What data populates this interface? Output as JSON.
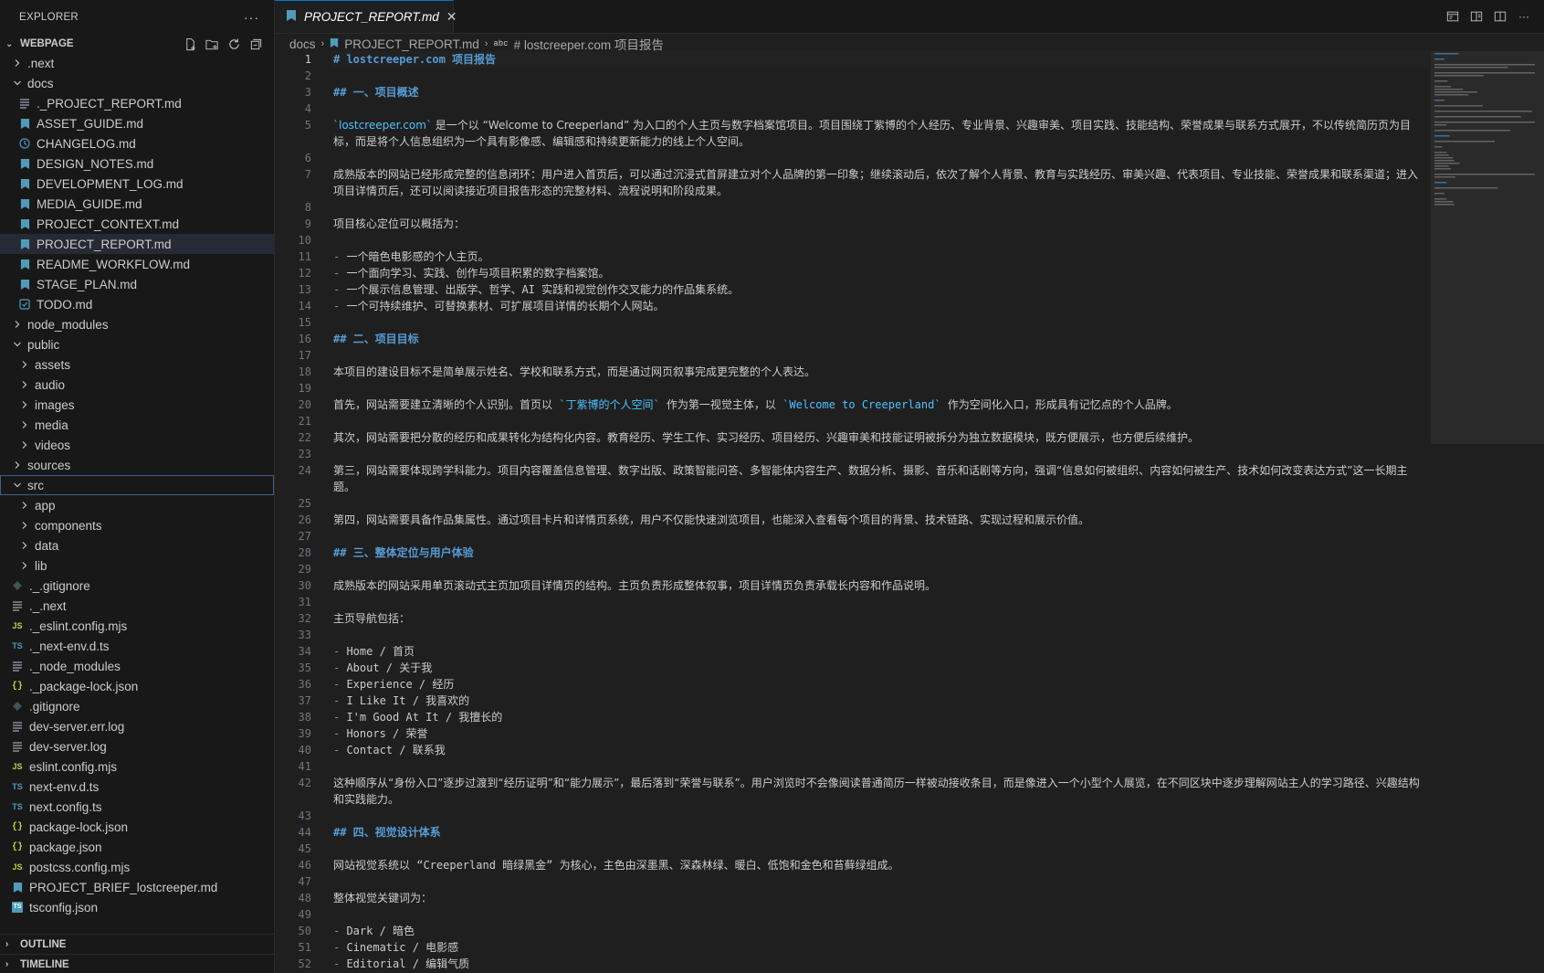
{
  "explorer": {
    "title": "EXPLORER",
    "more": "···",
    "workspace": "WEBPAGE",
    "items": [
      {
        "label": ".next",
        "kind": "folder",
        "depth": 0,
        "open": false
      },
      {
        "label": "docs",
        "kind": "folder",
        "depth": 0,
        "open": true
      },
      {
        "label": "._PROJECT_REPORT.md",
        "kind": "lines",
        "depth": 1
      },
      {
        "label": "ASSET_GUIDE.md",
        "kind": "md",
        "depth": 1
      },
      {
        "label": "CHANGELOG.md",
        "kind": "clock",
        "depth": 1
      },
      {
        "label": "DESIGN_NOTES.md",
        "kind": "md",
        "depth": 1
      },
      {
        "label": "DEVELOPMENT_LOG.md",
        "kind": "md",
        "depth": 1
      },
      {
        "label": "MEDIA_GUIDE.md",
        "kind": "md",
        "depth": 1
      },
      {
        "label": "PROJECT_CONTEXT.md",
        "kind": "md",
        "depth": 1
      },
      {
        "label": "PROJECT_REPORT.md",
        "kind": "md",
        "depth": 1,
        "selected": true
      },
      {
        "label": "README_WORKFLOW.md",
        "kind": "md",
        "depth": 1
      },
      {
        "label": "STAGE_PLAN.md",
        "kind": "md",
        "depth": 1
      },
      {
        "label": "TODO.md",
        "kind": "check",
        "depth": 1
      },
      {
        "label": "node_modules",
        "kind": "folder",
        "depth": 0,
        "open": false
      },
      {
        "label": "public",
        "kind": "folder",
        "depth": 0,
        "open": true
      },
      {
        "label": "assets",
        "kind": "folder",
        "depth": 1,
        "open": false
      },
      {
        "label": "audio",
        "kind": "folder",
        "depth": 1,
        "open": false
      },
      {
        "label": "images",
        "kind": "folder",
        "depth": 1,
        "open": false
      },
      {
        "label": "media",
        "kind": "folder",
        "depth": 1,
        "open": false
      },
      {
        "label": "videos",
        "kind": "folder",
        "depth": 1,
        "open": false
      },
      {
        "label": "sources",
        "kind": "folder",
        "depth": 0,
        "open": false
      },
      {
        "label": "src",
        "kind": "folder",
        "depth": 0,
        "open": true,
        "focused": true
      },
      {
        "label": "app",
        "kind": "folder",
        "depth": 1,
        "open": false
      },
      {
        "label": "components",
        "kind": "folder",
        "depth": 1,
        "open": false
      },
      {
        "label": "data",
        "kind": "folder",
        "depth": 1,
        "open": false
      },
      {
        "label": "lib",
        "kind": "folder",
        "depth": 1,
        "open": false
      },
      {
        "label": "._.gitignore",
        "kind": "git",
        "depth": 0
      },
      {
        "label": "._.next",
        "kind": "lines",
        "depth": 0
      },
      {
        "label": "._eslint.config.mjs",
        "kind": "js",
        "depth": 0
      },
      {
        "label": "._next-env.d.ts",
        "kind": "ts",
        "depth": 0
      },
      {
        "label": "._node_modules",
        "kind": "lines",
        "depth": 0
      },
      {
        "label": "._package-lock.json",
        "kind": "json",
        "depth": 0
      },
      {
        "label": ".gitignore",
        "kind": "git",
        "depth": 0
      },
      {
        "label": "dev-server.err.log",
        "kind": "lines",
        "depth": 0
      },
      {
        "label": "dev-server.log",
        "kind": "lines",
        "depth": 0
      },
      {
        "label": "eslint.config.mjs",
        "kind": "js",
        "depth": 0
      },
      {
        "label": "next-env.d.ts",
        "kind": "ts",
        "depth": 0
      },
      {
        "label": "next.config.ts",
        "kind": "ts",
        "depth": 0
      },
      {
        "label": "package-lock.json",
        "kind": "json",
        "depth": 0
      },
      {
        "label": "package.json",
        "kind": "json",
        "depth": 0
      },
      {
        "label": "postcss.config.mjs",
        "kind": "js",
        "depth": 0
      },
      {
        "label": "PROJECT_BRIEF_lostcreeper.md",
        "kind": "md",
        "depth": 0
      },
      {
        "label": "tsconfig.json",
        "kind": "tsconfig",
        "depth": 0
      }
    ],
    "outline": "OUTLINE",
    "timeline": "TIMELINE"
  },
  "editor": {
    "tab_label": "PROJECT_REPORT.md",
    "breadcrumb": [
      "docs",
      "PROJECT_REPORT.md",
      "# lostcreeper.com 项目报告"
    ],
    "active_line": 1,
    "lines": [
      {
        "n": 1,
        "text": "# lostcreeper.com 项目报告",
        "style": "h"
      },
      {
        "n": 2,
        "text": ""
      },
      {
        "n": 3,
        "text": "## 一、项目概述",
        "style": "h"
      },
      {
        "n": 4,
        "text": ""
      },
      {
        "n": 5,
        "text": "`lostcreeper.com` 是一个以 “Welcome to Creeperland” 为入口的个人主页与数字档案馆项目。项目围绕丁紫博的个人经历、专业背景、兴趣审美、项目实践、技能结构、荣誉成果与联系方式展开，不以传统简历页为目标，而是将个人信息组织为一个具有影像感、编辑感和持续更新能力的线上个人空间。",
        "rows": 2
      },
      {
        "n": 6,
        "text": ""
      },
      {
        "n": 7,
        "text": "成熟版本的网站已经形成完整的信息闭环：用户进入首页后，可以通过沉浸式首屏建立对个人品牌的第一印象；继续滚动后，依次了解个人背景、教育与实践经历、审美兴趣、代表项目、专业技能、荣誉成果和联系渠道；进入项目详情页后，还可以阅读接近项目报告形态的完整材料、流程说明和阶段成果。",
        "rows": 2
      },
      {
        "n": 8,
        "text": ""
      },
      {
        "n": 9,
        "text": "项目核心定位可以概括为："
      },
      {
        "n": 10,
        "text": ""
      },
      {
        "n": 11,
        "text": "- 一个暗色电影感的个人主页。",
        "style": "li"
      },
      {
        "n": 12,
        "text": "- 一个面向学习、实践、创作与项目积累的数字档案馆。",
        "style": "li"
      },
      {
        "n": 13,
        "text": "- 一个展示信息管理、出版学、哲学、AI 实践和视觉创作交叉能力的作品集系统。",
        "style": "li"
      },
      {
        "n": 14,
        "text": "- 一个可持续维护、可替换素材、可扩展项目详情的长期个人网站。",
        "style": "li"
      },
      {
        "n": 15,
        "text": ""
      },
      {
        "n": 16,
        "text": "## 二、项目目标",
        "style": "h"
      },
      {
        "n": 17,
        "text": ""
      },
      {
        "n": 18,
        "text": "本项目的建设目标不是简单展示姓名、学校和联系方式，而是通过网页叙事完成更完整的个人表达。"
      },
      {
        "n": 19,
        "text": ""
      },
      {
        "n": 20,
        "text": "首先，网站需要建立清晰的个人识别。首页以 `丁紫博的个人空间` 作为第一视觉主体，以 `Welcome to Creeperland` 作为空间化入口，形成具有记忆点的个人品牌。"
      },
      {
        "n": 21,
        "text": ""
      },
      {
        "n": 22,
        "text": "其次，网站需要把分散的经历和成果转化为结构化内容。教育经历、学生工作、实习经历、项目经历、兴趣审美和技能证明被拆分为独立数据模块，既方便展示，也方便后续维护。"
      },
      {
        "n": 23,
        "text": ""
      },
      {
        "n": 24,
        "text": "第三，网站需要体现跨学科能力。项目内容覆盖信息管理、数字出版、政策智能问答、多智能体内容生产、数据分析、摄影、音乐和话剧等方向，强调“信息如何被组织、内容如何被生产、技术如何改变表达方式”这一长期主题。",
        "rows": 2
      },
      {
        "n": 25,
        "text": ""
      },
      {
        "n": 26,
        "text": "第四，网站需要具备作品集属性。通过项目卡片和详情页系统，用户不仅能快速浏览项目，也能深入查看每个项目的背景、技术链路、实现过程和展示价值。"
      },
      {
        "n": 27,
        "text": ""
      },
      {
        "n": 28,
        "text": "## 三、整体定位与用户体验",
        "style": "h"
      },
      {
        "n": 29,
        "text": ""
      },
      {
        "n": 30,
        "text": "成熟版本的网站采用单页滚动式主页加项目详情页的结构。主页负责形成整体叙事，项目详情页负责承载长内容和作品说明。"
      },
      {
        "n": 31,
        "text": ""
      },
      {
        "n": 32,
        "text": "主页导航包括："
      },
      {
        "n": 33,
        "text": ""
      },
      {
        "n": 34,
        "text": "- Home / 首页",
        "style": "li"
      },
      {
        "n": 35,
        "text": "- About / 关于我",
        "style": "li"
      },
      {
        "n": 36,
        "text": "- Experience / 经历",
        "style": "li"
      },
      {
        "n": 37,
        "text": "- I Like It / 我喜欢的",
        "style": "li"
      },
      {
        "n": 38,
        "text": "- I'm Good At It / 我擅长的",
        "style": "li"
      },
      {
        "n": 39,
        "text": "- Honors / 荣誉",
        "style": "li"
      },
      {
        "n": 40,
        "text": "- Contact / 联系我",
        "style": "li"
      },
      {
        "n": 41,
        "text": ""
      },
      {
        "n": 42,
        "text": "这种顺序从“身份入口”逐步过渡到“经历证明”和“能力展示”，最后落到“荣誉与联系”。用户浏览时不会像阅读普通简历一样被动接收条目，而是像进入一个小型个人展览，在不同区块中逐步理解网站主人的学习路径、兴趣结构和实践能力。",
        "rows": 2
      },
      {
        "n": 43,
        "text": ""
      },
      {
        "n": 44,
        "text": "## 四、视觉设计体系",
        "style": "h"
      },
      {
        "n": 45,
        "text": ""
      },
      {
        "n": 46,
        "text": "网站视觉系统以 “Creeperland 暗绿黑金” 为核心，主色由深墨黑、深森林绿、暖白、低饱和金色和苔藓绿组成。"
      },
      {
        "n": 47,
        "text": ""
      },
      {
        "n": 48,
        "text": "整体视觉关键词为："
      },
      {
        "n": 49,
        "text": ""
      },
      {
        "n": 50,
        "text": "- Dark / 暗色",
        "style": "li"
      },
      {
        "n": 51,
        "text": "- Cinematic / 电影感",
        "style": "li"
      },
      {
        "n": 52,
        "text": "- Editorial / 编辑气质",
        "style": "li"
      }
    ]
  },
  "colors": {
    "accent": "#0078d4",
    "heading": "#569cd6",
    "list_marker": "#6796e6",
    "inline_code": "#ce9178"
  }
}
